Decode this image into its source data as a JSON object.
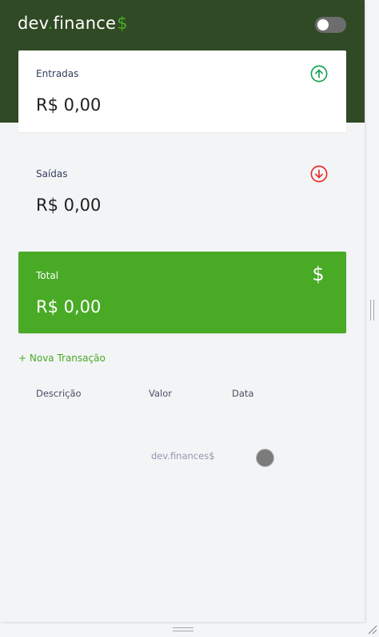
{
  "brand": {
    "name_part1": "dev",
    "name_part2": "finance",
    "dollar": "$"
  },
  "theme_toggle": {
    "state": "off"
  },
  "cards": {
    "income": {
      "label": "Entradas",
      "value": "R$ 0,00",
      "icon": "arrow-up-circle-icon",
      "color": "#12a454"
    },
    "expense": {
      "label": "Saídas",
      "value": "R$ 0,00",
      "icon": "arrow-down-circle-icon",
      "color": "#e92929"
    },
    "total": {
      "label": "Total",
      "value": "R$ 0,00",
      "icon": "dollar-icon",
      "icon_glyph": "$",
      "color": "#49aa26"
    }
  },
  "actions": {
    "new_transaction": "+ Nova Transação"
  },
  "table": {
    "headers": [
      "Descrição",
      "Valor",
      "Data"
    ]
  },
  "footer": {
    "brand": "dev.finances$"
  },
  "colors": {
    "header_bg": "#2f4a24",
    "accent": "#49aa26",
    "background": "#f3f4f6"
  }
}
